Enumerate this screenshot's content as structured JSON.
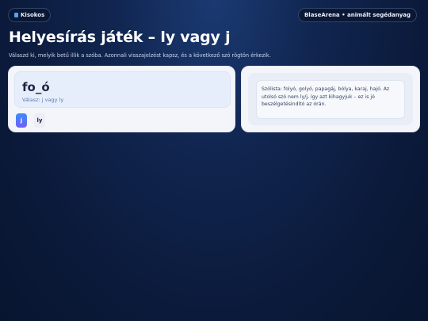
{
  "header": {
    "left_label": "Kisokos",
    "right_label": "BlaseArena • animált segédanyag"
  },
  "page": {
    "title": "Helyesírás játék – ly vagy j",
    "subtitle": "Válaszd ki, melyik betű illik a szóba. Azonnali visszajelzést kapsz, és a következő szó rögtön érkezik."
  },
  "quiz": {
    "word": "fo_ó",
    "hint": "Válasz: j vagy ly",
    "options": [
      "j",
      "ly"
    ]
  },
  "feedback": {
    "text": "Szólista: folyó, golyó, papagáj, bólya, karaj, hajó. Az utolsó szó nem ly/j, így azt kihagyjuk – ez is jó beszélgetésindító az órán."
  },
  "colors": {
    "accent": "#3c8bff",
    "accent2": "#6f5ff5",
    "background": "#0b1a3a"
  },
  "icons": {
    "header_left": "book-icon"
  }
}
